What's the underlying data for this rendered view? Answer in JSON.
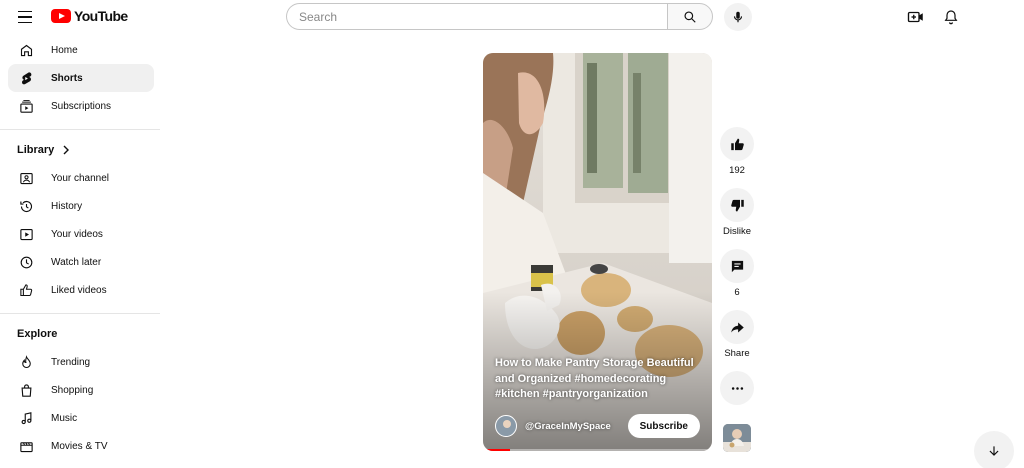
{
  "header": {
    "logo_text": "YouTube",
    "search_placeholder": "Search"
  },
  "sidebar": {
    "main": [
      {
        "label": "Home",
        "icon": "home-icon"
      },
      {
        "label": "Shorts",
        "icon": "shorts-icon",
        "active": true
      },
      {
        "label": "Subscriptions",
        "icon": "subscriptions-icon"
      }
    ],
    "library_title": "Library",
    "library": [
      {
        "label": "Your channel",
        "icon": "channel-icon"
      },
      {
        "label": "History",
        "icon": "history-icon"
      },
      {
        "label": "Your videos",
        "icon": "your-videos-icon"
      },
      {
        "label": "Watch later",
        "icon": "watch-later-icon"
      },
      {
        "label": "Liked videos",
        "icon": "liked-videos-icon"
      }
    ],
    "explore_title": "Explore",
    "explore": [
      {
        "label": "Trending",
        "icon": "trending-icon"
      },
      {
        "label": "Shopping",
        "icon": "shopping-icon"
      },
      {
        "label": "Music",
        "icon": "music-icon"
      },
      {
        "label": "Movies & TV",
        "icon": "movies-icon"
      }
    ]
  },
  "short": {
    "caption": "How to Make Pantry Storage Beautiful and Organized #homedecorating #kitchen #pantryorganization",
    "channel": "@GraceInMySpace",
    "subscribe_label": "Subscribe",
    "progress": 0.12
  },
  "actions": {
    "like_count": "192",
    "dislike_label": "Dislike",
    "comment_count": "6",
    "share_label": "Share"
  },
  "colors": {
    "brand": "#ff0000",
    "text": "#0f0f0f",
    "button_bg": "#f2f2f2",
    "active_bg": "#f0f0f0"
  }
}
